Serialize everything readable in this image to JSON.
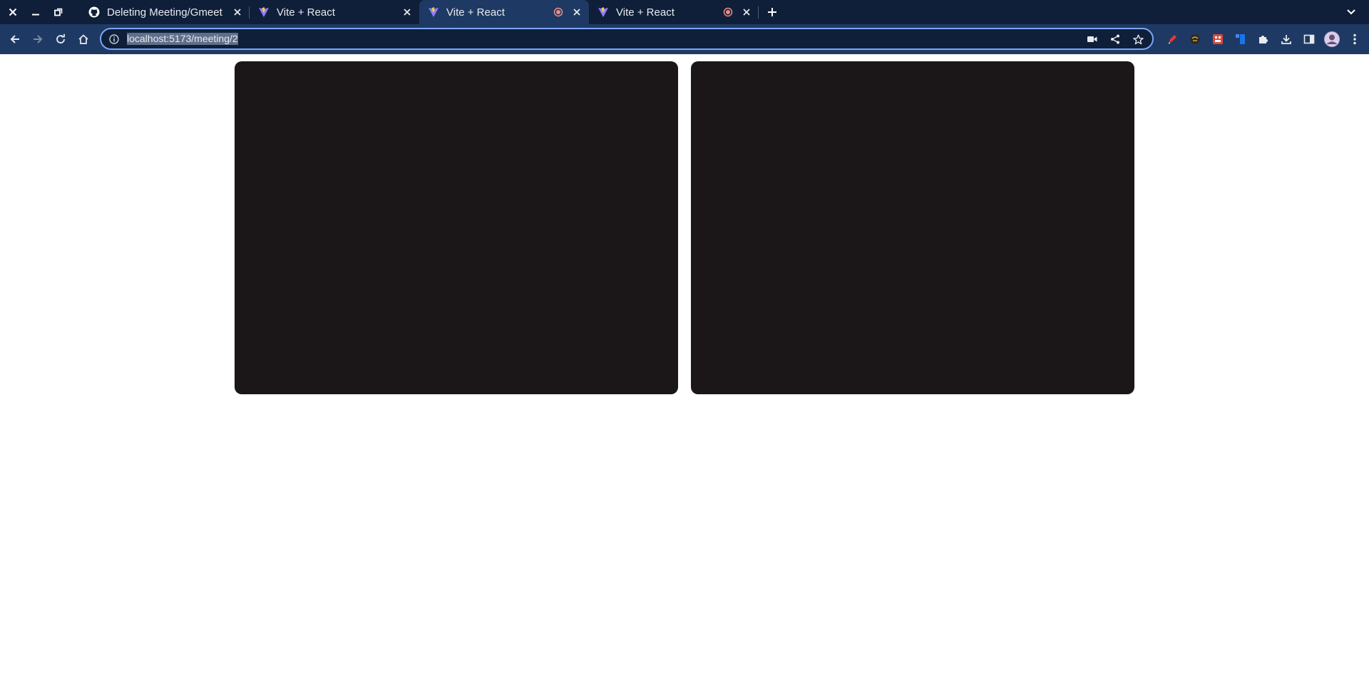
{
  "window_controls": {
    "close": "close-icon",
    "minimize": "minimize-icon",
    "restore": "restore-icon"
  },
  "tabs": [
    {
      "title": "Deleting Meeting/Gmeet",
      "favicon": "github-icon",
      "recording": false,
      "active": false
    },
    {
      "title": "Vite + React",
      "favicon": "vite-icon",
      "recording": false,
      "active": false
    },
    {
      "title": "Vite + React",
      "favicon": "vite-icon",
      "recording": true,
      "active": true
    },
    {
      "title": "Vite + React",
      "favicon": "vite-icon",
      "recording": true,
      "active": false
    }
  ],
  "toolbar": {
    "back": "back-arrow-icon",
    "forward": "forward-arrow-icon",
    "reload": "reload-icon",
    "home": "home-icon"
  },
  "omnibox": {
    "url": "localhost:5173/meeting/2",
    "site_info": "info-icon",
    "actions": [
      "camera-icon",
      "share-icon",
      "star-icon"
    ]
  },
  "extensions": [
    "red-pen-icon",
    "mask-icon",
    "pixel-icon",
    "blue-bookmark-icon",
    "puzzle-icon",
    "download-icon",
    "side-panel-icon",
    "avatar",
    "kebab-menu-icon"
  ],
  "colors": {
    "tabstrip": "#0f1f3a",
    "toolbar": "#1e3a64",
    "video_bg": "#1b1719",
    "focus_ring": "#7ca6f4"
  },
  "videos": [
    {
      "name": "local-video"
    },
    {
      "name": "remote-video"
    }
  ]
}
